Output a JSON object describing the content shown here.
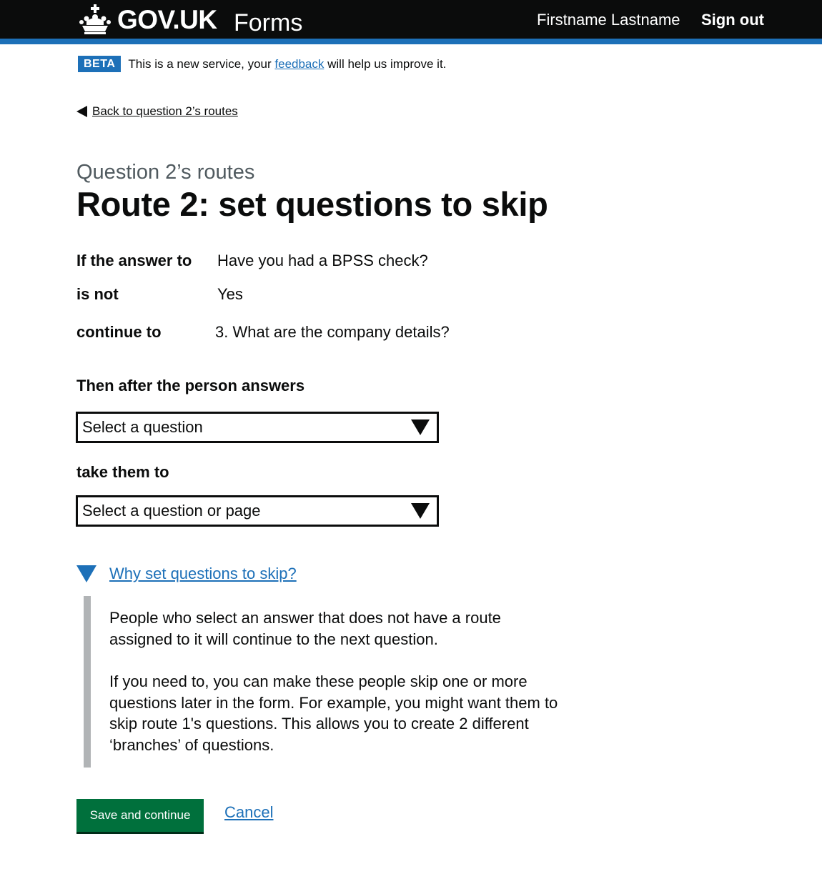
{
  "header": {
    "logotype": "GOV.UK",
    "service_name": "Forms",
    "user_name": "Firstname Lastname",
    "sign_out": "Sign out"
  },
  "phase_banner": {
    "tag": "BETA",
    "text_before": "This is a new service, your ",
    "link": "feedback",
    "text_after": " will help us improve it."
  },
  "back_link": "Back to question 2’s routes",
  "caption": "Question 2’s routes",
  "heading": "Route 2: set questions to skip",
  "summary": [
    {
      "key": "If the answer to",
      "value": "Have you had a BPSS check?"
    },
    {
      "key": "is not",
      "value": "Yes"
    },
    {
      "key": "continue to",
      "value": "3. What are the company details?"
    }
  ],
  "fields": {
    "after_label": "Then after the person answers",
    "after_selected": "Select a question",
    "take_label": "take them to",
    "take_selected": "Select a question or page"
  },
  "details": {
    "summary": "Why set questions to skip?",
    "paragraph_1": "People who select an answer that does not have a route assigned to it will continue to the next question.",
    "paragraph_2": "If you need to, you can make these people skip one or more questions later in the form. For example, you might want them to skip route 1's questions. This allows you to create 2 different ‘branches’ of questions."
  },
  "actions": {
    "save": "Save and continue",
    "cancel": "Cancel"
  },
  "colors": {
    "brand_blue": "#1d70b8",
    "button_green": "#00703c",
    "text": "#0b0c0c",
    "secondary_text": "#505a5f"
  }
}
